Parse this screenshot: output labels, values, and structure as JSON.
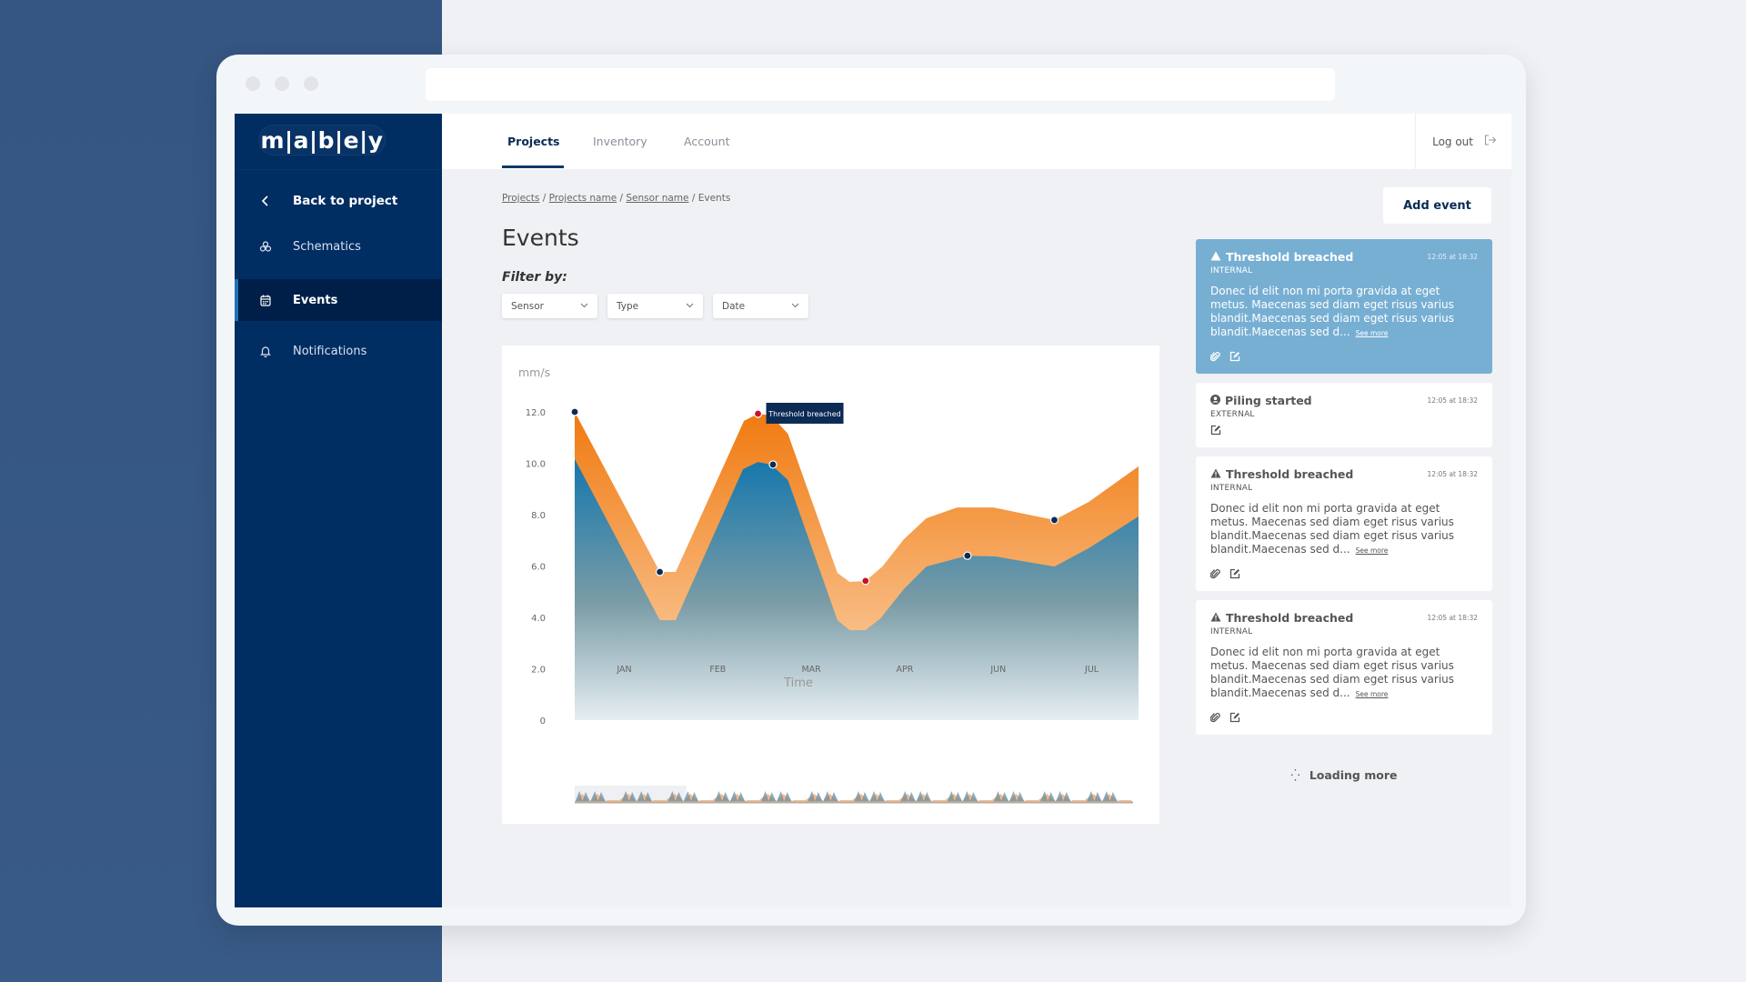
{
  "window": {
    "url": ""
  },
  "brand": {
    "logo": "m|a|b|e|y"
  },
  "sidebar": {
    "back": {
      "label": "Back to project",
      "icon": "chevron-left-icon"
    },
    "items": [
      {
        "label": "Schematics",
        "icon": "schematics-icon",
        "active": false
      },
      {
        "label": "Events",
        "icon": "calendar-icon",
        "active": true
      },
      {
        "label": "Notifications",
        "icon": "bell-icon",
        "active": false
      }
    ]
  },
  "header": {
    "tabs": [
      {
        "label": "Projects",
        "active": true
      },
      {
        "label": "Inventory",
        "active": false
      },
      {
        "label": "Account",
        "active": false
      }
    ],
    "logout": "Log out"
  },
  "breadcrumb": [
    {
      "label": "Projects",
      "link": true
    },
    {
      "label": "Projects name",
      "link": true
    },
    {
      "label": "Sensor name",
      "link": true
    },
    {
      "label": "Events",
      "link": false
    }
  ],
  "page": {
    "title": "Events",
    "filter_label": "Filter by:",
    "filters": [
      {
        "label": "Sensor"
      },
      {
        "label": "Type"
      },
      {
        "label": "Date"
      }
    ],
    "add_event": "Add event"
  },
  "chart_data": {
    "type": "area",
    "title": "",
    "ylabel": "mm/s",
    "xlabel": "Time",
    "ylim": [
      0,
      12
    ],
    "yticks": [
      "0",
      "2.0",
      "4.0",
      "6.0",
      "8.0",
      "10.0",
      "12.0"
    ],
    "ytick_values": [
      0,
      2,
      4,
      6,
      8,
      10,
      12
    ],
    "categories": [
      "JAN",
      "FEB",
      "MAR",
      "APR",
      "JUN",
      "JUL"
    ],
    "xlim": [
      0,
      6.03
    ],
    "grid": false,
    "series": [
      {
        "name": "upper",
        "color": "#f0841c",
        "x": [
          0,
          0.91,
          1.08,
          1.81,
          1.96,
          2.1,
          2.28,
          2.81,
          2.94,
          3.11,
          3.29,
          3.52,
          3.76,
          4.09,
          4.48,
          5.13,
          5.5,
          6.03
        ],
        "values": [
          12.0,
          5.77,
          5.77,
          11.65,
          11.93,
          11.86,
          11.15,
          5.73,
          5.38,
          5.42,
          5.98,
          7.04,
          7.86,
          8.28,
          8.28,
          7.79,
          8.5,
          9.88
        ]
      },
      {
        "name": "lower",
        "color": "#1a79ad",
        "x": [
          0,
          0.91,
          1.08,
          1.8,
          1.96,
          2.1,
          2.28,
          2.81,
          2.94,
          3.11,
          3.27,
          3.52,
          3.76,
          4.19,
          4.5,
          5.13,
          5.5,
          6.03
        ],
        "values": [
          10.16,
          3.89,
          3.89,
          9.77,
          10.05,
          9.95,
          9.35,
          3.89,
          3.5,
          3.5,
          3.96,
          5.1,
          5.98,
          6.4,
          6.37,
          5.98,
          6.7,
          7.93
        ]
      }
    ],
    "markers": [
      {
        "x": 0,
        "value": 12.0,
        "status": "normal"
      },
      {
        "x": 0.91,
        "value": 5.77,
        "status": "normal"
      },
      {
        "x": 1.96,
        "value": 11.93,
        "status": "breach"
      },
      {
        "x": 2.12,
        "value": 9.95,
        "status": "normal"
      },
      {
        "x": 3.11,
        "value": 5.42,
        "status": "breach"
      },
      {
        "x": 4.2,
        "value": 6.4,
        "status": "normal"
      },
      {
        "x": 5.13,
        "value": 7.79,
        "status": "normal"
      }
    ],
    "tooltip": {
      "text": "Threshold breached",
      "x": 1.96,
      "value": 11.93
    },
    "colors": {
      "normal_marker": "#0b2b55",
      "breach_marker": "#c8102e",
      "tooltip_bg": "#0b2b55"
    },
    "range_selector": {
      "selected_fraction": [
        0,
        0.2
      ]
    }
  },
  "events": [
    {
      "title": "Threshold breached",
      "icon": "warning-icon",
      "time": "12:05 at 18:32",
      "tag": "INTERNAL",
      "body": "Donec id elit non mi porta gravida at eget metus. Maecenas sed diam eget risus varius blandit.Maecenas sed diam eget risus varius blandit.Maecenas sed d...",
      "see_more": "See more",
      "attachment": true,
      "selected": true
    },
    {
      "title": "Piling started",
      "icon": "user-circle-icon",
      "time": "12:05 at 18:32",
      "tag": "EXTERNAL",
      "body": "",
      "see_more": "",
      "attachment": false,
      "selected": false
    },
    {
      "title": "Threshold breached",
      "icon": "warning-icon",
      "time": "12:05 at 18:32",
      "tag": "INTERNAL",
      "body": "Donec id elit non mi porta gravida at eget metus. Maecenas sed diam eget risus varius blandit.Maecenas sed diam eget risus varius blandit.Maecenas sed d...",
      "see_more": "See more",
      "attachment": true,
      "selected": false
    },
    {
      "title": "Threshold breached",
      "icon": "warning-icon",
      "time": "12:05 at 18:32",
      "tag": "INTERNAL",
      "body": "Donec id elit non mi porta gravida at eget metus. Maecenas sed diam eget risus varius blandit.Maecenas sed diam eget risus varius blandit.Maecenas sed d...",
      "see_more": "See more",
      "attachment": true,
      "selected": false
    }
  ],
  "loading": {
    "label": "Loading more"
  },
  "colors": {
    "sidebar": "#002d62",
    "sidebar_active": "#001f48",
    "accent": "#0b2b55",
    "selected_card": "#77afd3",
    "background_panel": "#355582"
  }
}
